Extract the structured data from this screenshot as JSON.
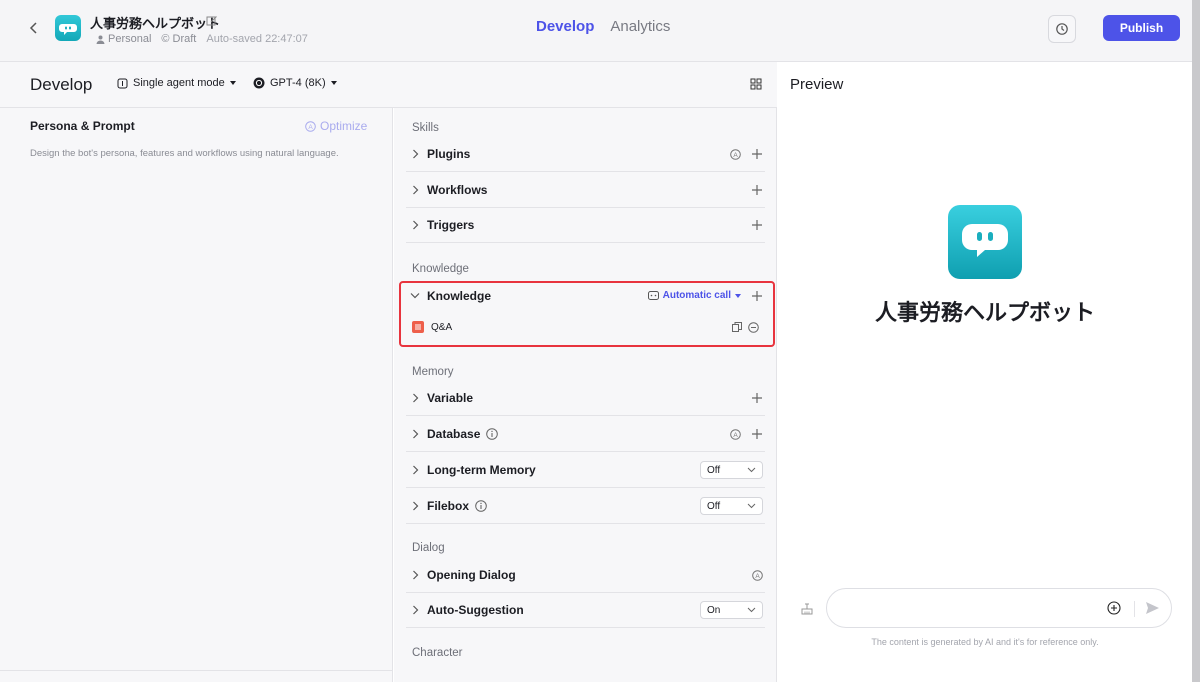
{
  "header": {
    "bot_name": "人事労務ヘルプボット",
    "owner": "Personal",
    "status": "Draft",
    "autosave": "Auto-saved 22:47:07",
    "tabs": [
      {
        "label": "Develop",
        "active": true
      },
      {
        "label": "Analytics",
        "active": false
      }
    ],
    "publish_label": "Publish"
  },
  "develop": {
    "title": "Develop",
    "mode": "Single agent mode",
    "model": "GPT-4 (8K)"
  },
  "persona": {
    "title": "Persona & Prompt",
    "optimize_label": "Optimize",
    "description": "Design the bot's persona, features and workflows using natural language."
  },
  "sections": {
    "skills": "Skills",
    "knowledge": "Knowledge",
    "memory": "Memory",
    "dialog": "Dialog",
    "character": "Character"
  },
  "rows": {
    "plugins": "Plugins",
    "workflows": "Workflows",
    "triggers": "Triggers",
    "knowledge": "Knowledge",
    "variable": "Variable",
    "database": "Database",
    "long_term_memory": "Long-term Memory",
    "filebox": "Filebox",
    "opening_dialog": "Opening Dialog",
    "auto_suggestion": "Auto-Suggestion"
  },
  "knowledge": {
    "call_mode": "Automatic call",
    "items": [
      {
        "label": "Q&A"
      }
    ]
  },
  "selects": {
    "long_term_memory": "Off",
    "filebox": "Off",
    "auto_suggestion": "On"
  },
  "preview": {
    "title": "Preview",
    "bot_name": "人事労務ヘルプボット",
    "input_placeholder": "",
    "disclaimer": "The content is generated by AI and it's for reference only."
  },
  "colors": {
    "accent": "#4d53e8",
    "highlight": "#e8343e",
    "bot_icon": "#1fb8c8"
  }
}
